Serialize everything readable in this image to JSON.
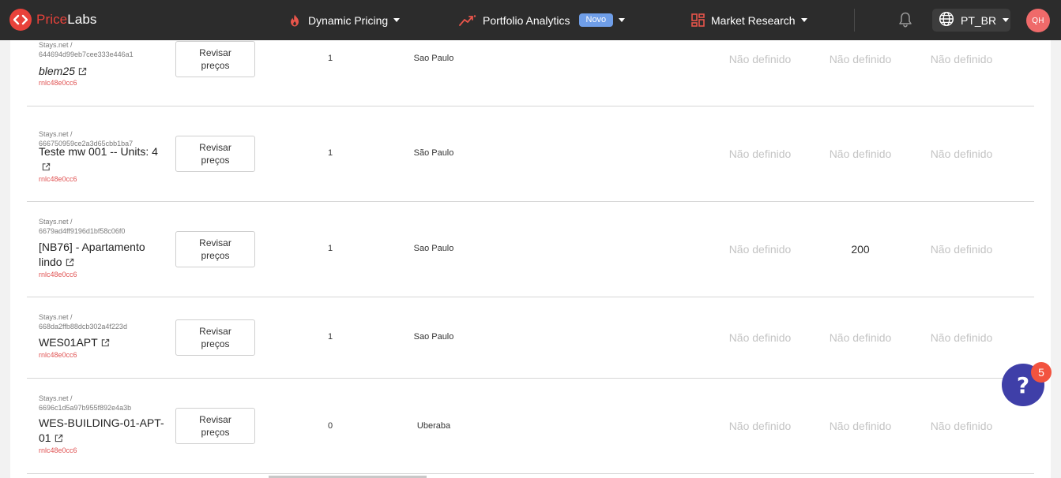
{
  "navbar": {
    "logo": {
      "part1": "Price",
      "part2": "Labs"
    },
    "dynamic_pricing": "Dynamic Pricing",
    "portfolio_analytics": "Portfolio Analytics",
    "portfolio_badge": "Novo",
    "market_research": "Market Research",
    "language": "PT_BR",
    "avatar_initials": "QH"
  },
  "listings": [
    {
      "source": "Stays.net /",
      "id": "644694d99eb7cee333e446a1",
      "name": "blem25",
      "owner": "rnlc48e0cc6",
      "review_label_1": "Revisar",
      "review_label_2": "preços",
      "units": "1",
      "city": "Sao Paulo",
      "col1": "Não definido",
      "col2": "Não definido",
      "col3": "Não definido"
    },
    {
      "source": "Stays.net /",
      "id": "666750959ce2a3d65cbb1ba7",
      "name": "Teste mw 001 -- Units: 4",
      "owner": "rnlc48e0cc6",
      "review_label_1": "Revisar",
      "review_label_2": "preços",
      "units": "1",
      "city": "São Paulo",
      "col1": "Não definido",
      "col2": "Não definido",
      "col3": "Não definido"
    },
    {
      "source": "Stays.net /",
      "id": "6679ad4ff9196d1bf58c06f0",
      "name": "[NB76] - Apartamento lindo",
      "owner": "rnlc48e0cc6",
      "review_label_1": "Revisar",
      "review_label_2": "preços",
      "units": "1",
      "city": "Sao Paulo",
      "col1": "Não definido",
      "col2": "200",
      "col3": "Não definido"
    },
    {
      "source": "Stays.net /",
      "id": "668da2ffb88dcb302a4f223d",
      "name": "WES01APT",
      "owner": "rnlc48e0cc6",
      "review_label_1": "Revisar",
      "review_label_2": "preços",
      "units": "1",
      "city": "Sao Paulo",
      "col1": "Não definido",
      "col2": "Não definido",
      "col3": "Não definido"
    },
    {
      "source": "Stays.net /",
      "id": "6696c1d5a97b955f892e4a3b",
      "name": "WES-BUILDING-01-APT-01",
      "owner": "rnlc48e0cc6",
      "review_label_1": "Revisar",
      "review_label_2": "preços",
      "units": "0",
      "city": "Uberaba",
      "col1": "Não definido",
      "col2": "Não definido",
      "col3": "Não definido"
    }
  ],
  "help": {
    "symbol": "?",
    "count": "5"
  },
  "colors": {
    "navbar": "#2c2c2c",
    "brand": "#e8423b",
    "badge": "#6f9ee8",
    "help": "#3f3fa8",
    "owner": "#e05252"
  }
}
